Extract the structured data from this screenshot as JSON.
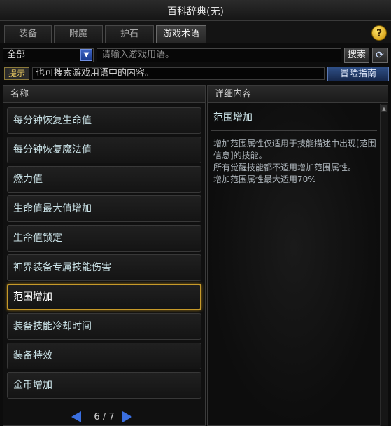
{
  "window": {
    "title": "百科辞典(无)"
  },
  "tabs": [
    {
      "label": "装备",
      "active": false
    },
    {
      "label": "附魔",
      "active": false
    },
    {
      "label": "护石",
      "active": false
    },
    {
      "label": "游戏术语",
      "active": true
    }
  ],
  "help": {
    "label": "?"
  },
  "search": {
    "category_value": "全部",
    "placeholder": "请输入游戏用语。",
    "search_label": "搜索",
    "refresh_icon": "refresh-icon"
  },
  "hint": {
    "tag": "提示",
    "text": "也可搜索游戏用语中的内容。",
    "guide_label": "冒险指南"
  },
  "list": {
    "header": "名称",
    "items": [
      {
        "label": "每分钟恢复生命值"
      },
      {
        "label": "每分钟恢复魔法值"
      },
      {
        "label": "燃力值"
      },
      {
        "label": "生命值最大值增加"
      },
      {
        "label": "生命值锁定"
      },
      {
        "label": "神界装备专属技能伤害"
      },
      {
        "label": "范围增加",
        "selected": true
      },
      {
        "label": "装备技能冷却时间"
      },
      {
        "label": "装备特效"
      },
      {
        "label": "金币增加"
      }
    ],
    "pager": {
      "text": "6 / 7"
    }
  },
  "detail": {
    "header": "详细内容",
    "title": "范围增加",
    "text": "增加范围属性仅适用于技能描述中出现[范围信息]的技能。\n所有觉醒技能都不适用增加范围属性。\n增加范围属性最大适用70%"
  },
  "colors": {
    "selected_border": "#c79a2a",
    "accent_blue": "#3a6fe0",
    "item_text": "#c9e1e6"
  }
}
